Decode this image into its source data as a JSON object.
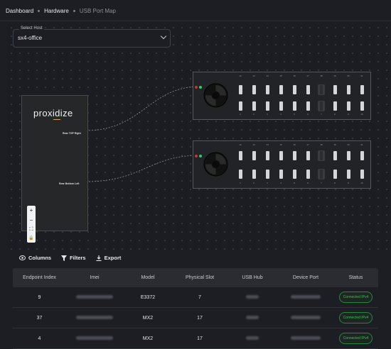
{
  "breadcrumb": {
    "items": [
      "Dashboard",
      "Hardware"
    ],
    "current": "USB Port Map"
  },
  "host": {
    "label": "Select Host",
    "value": "sx4-office"
  },
  "router": {
    "brand": "proxidize",
    "port_top": "Rear TOP Right",
    "port_bottom": "Rear Bottom Left"
  },
  "hubs": [
    {
      "top_numbers": [
        "0",
        "12",
        "13",
        "14",
        "15",
        "16",
        "17",
        "18",
        "19",
        "20",
        "21"
      ],
      "bottom_numbers": [
        "1",
        "2",
        "3",
        "4",
        "5",
        "6",
        "7",
        "8",
        "9",
        "10",
        "11"
      ],
      "highlight_index": 7
    },
    {
      "top_numbers": [
        "0",
        "12",
        "13",
        "14",
        "15",
        "16",
        "17",
        "18",
        "19",
        "20",
        "21"
      ],
      "bottom_numbers": [
        "1",
        "2",
        "3",
        "4",
        "5",
        "6",
        "7",
        "8",
        "9",
        "10",
        "11"
      ],
      "highlight_index": 7
    }
  ],
  "zoom_controls": {
    "zoom_in": "+",
    "zoom_out": "−",
    "fit": "⛶",
    "lock": "🔒"
  },
  "toolbar": {
    "columns": "Columns",
    "filters": "Filters",
    "export": "Export"
  },
  "table": {
    "headers": [
      "Endpoint Index",
      "Imei",
      "Model",
      "Physical Slot",
      "USB Hub",
      "Device Port",
      "Status"
    ],
    "rows": [
      {
        "endpoint": "9",
        "model": "E3372",
        "slot": "7",
        "status": "Connected IPv4"
      },
      {
        "endpoint": "37",
        "model": "MX2",
        "slot": "17",
        "status": "Connected IPv4"
      },
      {
        "endpoint": "4",
        "model": "MX2",
        "slot": "17",
        "status": "Connected IPv4"
      }
    ]
  },
  "colors": {
    "accent_green": "#33c45d",
    "logo_accent": "#d9a73a"
  }
}
